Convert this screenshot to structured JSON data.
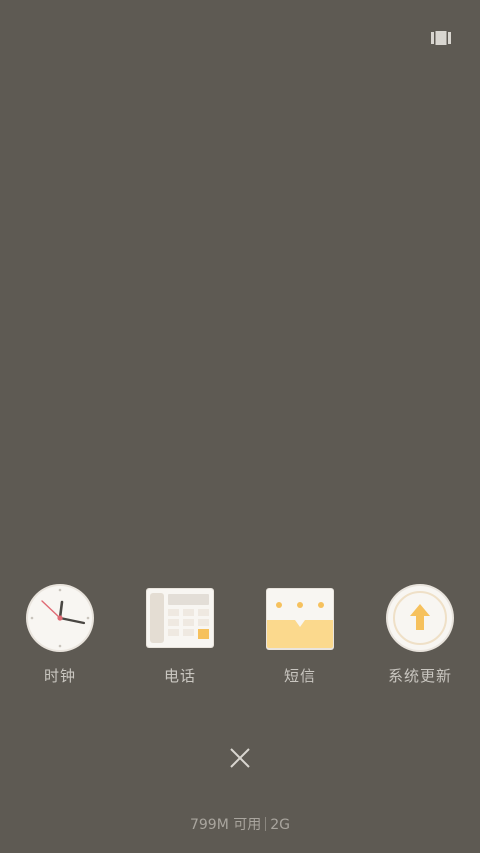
{
  "apps": [
    {
      "label": "时钟",
      "icon": "clock-icon"
    },
    {
      "label": "电话",
      "icon": "phone-icon"
    },
    {
      "label": "短信",
      "icon": "messages-icon"
    },
    {
      "label": "系统更新",
      "icon": "system-update-icon"
    }
  ],
  "memory": {
    "available": "799M 可用",
    "total": "2G"
  },
  "icons": {
    "top_right": "recents-layout-icon",
    "close": "close-icon"
  },
  "colors": {
    "background": "#5e5a53",
    "label_text": "#c9c6c0",
    "memory_text": "#a9a59e",
    "accent_orange": "#f6c15d",
    "clock_second_hand": "#e06a74"
  }
}
